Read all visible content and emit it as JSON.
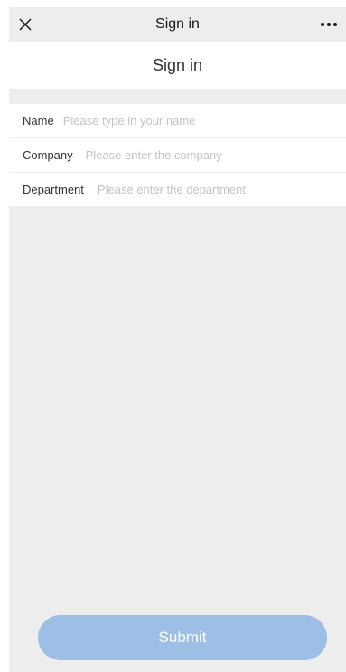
{
  "topbar": {
    "title": "Sign in",
    "close_icon": "close-icon",
    "more_icon": "more-icon"
  },
  "page": {
    "title": "Sign in"
  },
  "form": {
    "fields": [
      {
        "label": "Name",
        "placeholder": "Please type in your name",
        "value": ""
      },
      {
        "label": "Company",
        "placeholder": "Please enter the company",
        "value": ""
      },
      {
        "label": "Department",
        "placeholder": "Please enter the department",
        "value": ""
      }
    ]
  },
  "submit": {
    "label": "Submit"
  },
  "colors": {
    "background": "#ededed",
    "button": "#9dbfe6",
    "placeholder": "#c4c4c4",
    "text": "#333333"
  }
}
